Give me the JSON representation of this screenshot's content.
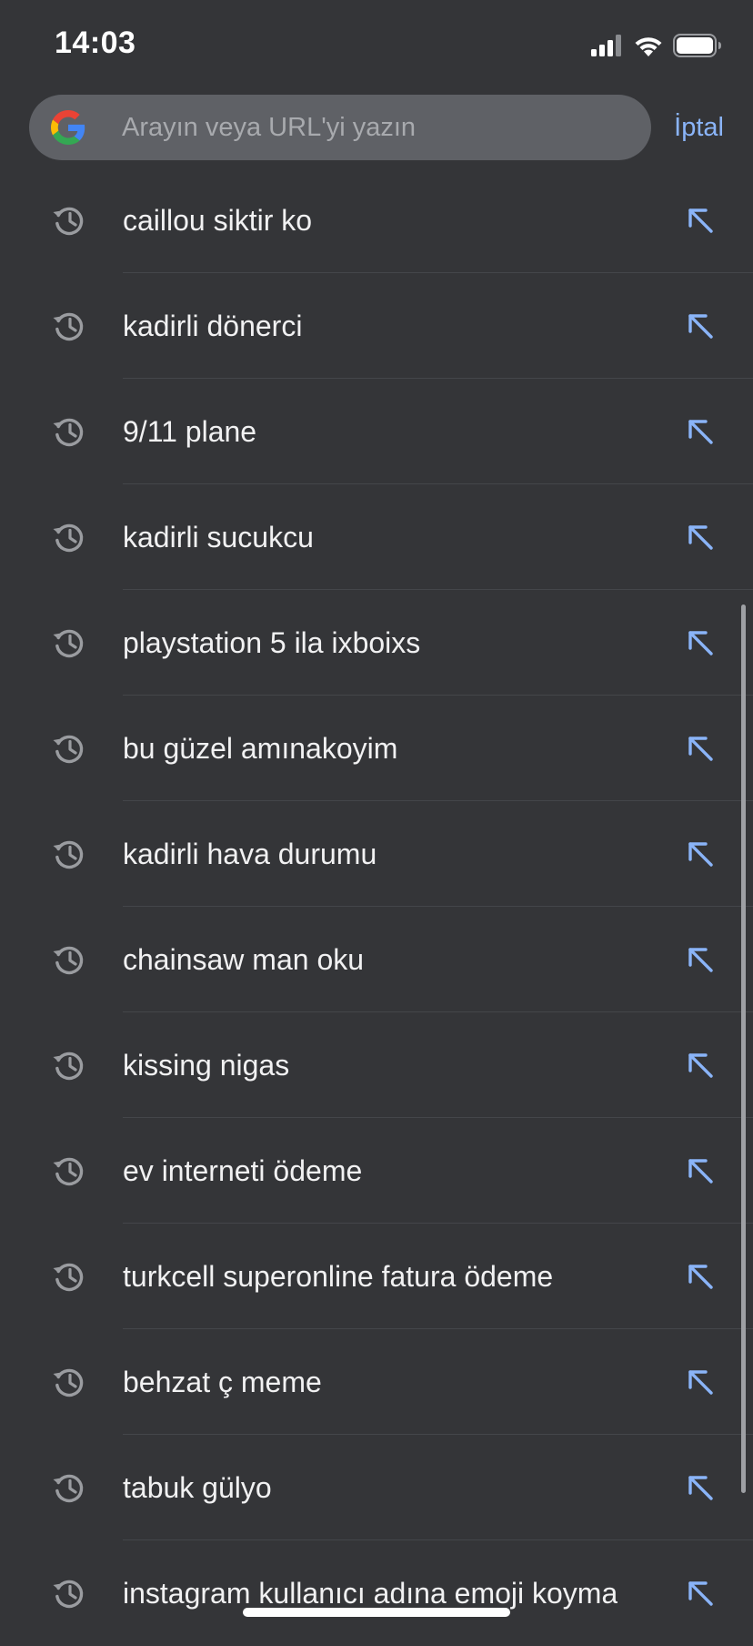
{
  "status_bar": {
    "time": "14:03",
    "icons": [
      "signal-icon",
      "wifi-icon",
      "battery-icon"
    ]
  },
  "search": {
    "placeholder": "Arayın veya URL'yi yazın",
    "value": "",
    "cancel_label": "İptal",
    "logo": "google-g-logo"
  },
  "colors": {
    "background": "#343538",
    "search_box": "#5f6166",
    "accent": "#8ab4f8",
    "history_icon": "#9a9ca0"
  },
  "history": {
    "icon": "history-clock-icon",
    "action_icon": "arrow-up-left-icon",
    "items": [
      {
        "label": "caillou siktir ko"
      },
      {
        "label": "kadirli dönerci"
      },
      {
        "label": "9/11 plane"
      },
      {
        "label": "kadirli sucukcu"
      },
      {
        "label": "playstation 5 ila ixboixs"
      },
      {
        "label": "bu güzel amınakoyim"
      },
      {
        "label": "kadirli hava durumu"
      },
      {
        "label": "chainsaw man oku"
      },
      {
        "label": "kissing nigas"
      },
      {
        "label": "ev interneti ödeme"
      },
      {
        "label": "turkcell superonline fatura ödeme"
      },
      {
        "label": "behzat ç meme"
      },
      {
        "label": "tabuk gülyo"
      },
      {
        "label": "instagram kullanıcı adına emoji koyma"
      }
    ]
  }
}
